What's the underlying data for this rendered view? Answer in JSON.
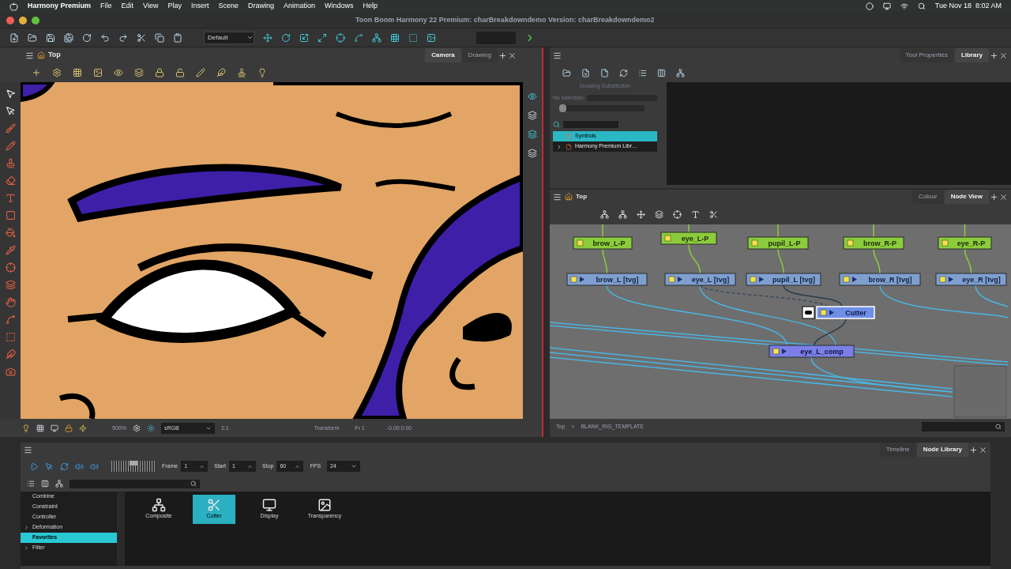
{
  "menubar": {
    "app": "Harmony Premium",
    "items": [
      "File",
      "Edit",
      "View",
      "Play",
      "Insert",
      "Scene",
      "Drawing",
      "Animation",
      "Windows",
      "Help"
    ],
    "clock": "Tue Nov 18  8:02 AM"
  },
  "window": {
    "title": "Toon Boom Harmony 22 Premium: charBreakdowndemo Version: charBreakdowndemo2"
  },
  "toolbar": {
    "preset": "Default"
  },
  "camera_view": {
    "breadcrumb": "Top",
    "tabs": [
      {
        "label": "Camera",
        "selected": true
      },
      {
        "label": "Drawing",
        "selected": false
      }
    ],
    "status": {
      "zoom": "500%",
      "color_space": "sRGB",
      "ratio": "1:1",
      "mode": "Transform",
      "frame": "Fr 1",
      "coords": "-0.00:0.00"
    }
  },
  "library_panel": {
    "tabs": [
      {
        "label": "Tool Properties",
        "selected": false
      },
      {
        "label": "Library",
        "selected": true
      }
    ],
    "substitution_title": "Drawing Substitution",
    "no_selection": "No selection",
    "substitution_slider": {
      "level": 0
    },
    "tree": [
      {
        "label": "Symbols",
        "selected": true,
        "has_children": false
      },
      {
        "label": "Harmony Premium Libr…",
        "selected": false,
        "has_children": true
      }
    ]
  },
  "node_view": {
    "breadcrumb": "Top",
    "tabs": [
      {
        "label": "Colour",
        "selected": false
      },
      {
        "label": "Node View",
        "selected": true
      }
    ],
    "nodes": [
      {
        "label": "brow_L-P",
        "kind": "peg",
        "selected": false
      },
      {
        "label": "eye_L-P",
        "kind": "peg",
        "selected": false
      },
      {
        "label": "pupil_L-P",
        "kind": "peg",
        "selected": false
      },
      {
        "label": "brow_R-P",
        "kind": "peg",
        "selected": false
      },
      {
        "label": "eye_R-P",
        "kind": "peg",
        "selected": false
      },
      {
        "label": "brow_L  [tvg]",
        "kind": "drawing",
        "selected": false
      },
      {
        "label": "eye_L  [tvg]",
        "kind": "drawing",
        "selected": false
      },
      {
        "label": "pupil_L  [tvg]",
        "kind": "drawing",
        "selected": false
      },
      {
        "label": "brow_R  [tvg]",
        "kind": "drawing",
        "selected": false
      },
      {
        "label": "eye_R  [tvg]",
        "kind": "drawing",
        "selected": false
      },
      {
        "label": "Cutter",
        "kind": "cutter",
        "selected": true
      },
      {
        "label": "eye_L_comp",
        "kind": "composite",
        "selected": false
      }
    ],
    "path": [
      "Top",
      ">",
      "BLANK_RIG_TEMPLATE"
    ]
  },
  "bottom_panel": {
    "tabs": [
      {
        "label": "Timeline",
        "selected": false
      },
      {
        "label": "Node Library",
        "selected": true
      }
    ],
    "speed_slider": {
      "level": 0.5
    },
    "playback": [
      {
        "label": "Frame",
        "value": "1"
      },
      {
        "label": "Start",
        "value": "1"
      },
      {
        "label": "Stop",
        "value": "60"
      }
    ],
    "fps": {
      "label": "FPS",
      "value": "24"
    },
    "categories": [
      {
        "label": "Combine",
        "selected": false,
        "has_children": false
      },
      {
        "label": "Constraint",
        "selected": false,
        "has_children": false
      },
      {
        "label": "Controller",
        "selected": false,
        "has_children": false
      },
      {
        "label": "Deformation",
        "selected": false,
        "has_children": true
      },
      {
        "label": "Favorites",
        "selected": true,
        "has_children": false
      },
      {
        "label": "Filter",
        "selected": false,
        "has_children": true
      }
    ],
    "items": [
      {
        "label": "Composite",
        "selected": false
      },
      {
        "label": "Cutter",
        "selected": true
      },
      {
        "label": "Display",
        "selected": false
      },
      {
        "label": "Transparency",
        "selected": false
      }
    ]
  }
}
